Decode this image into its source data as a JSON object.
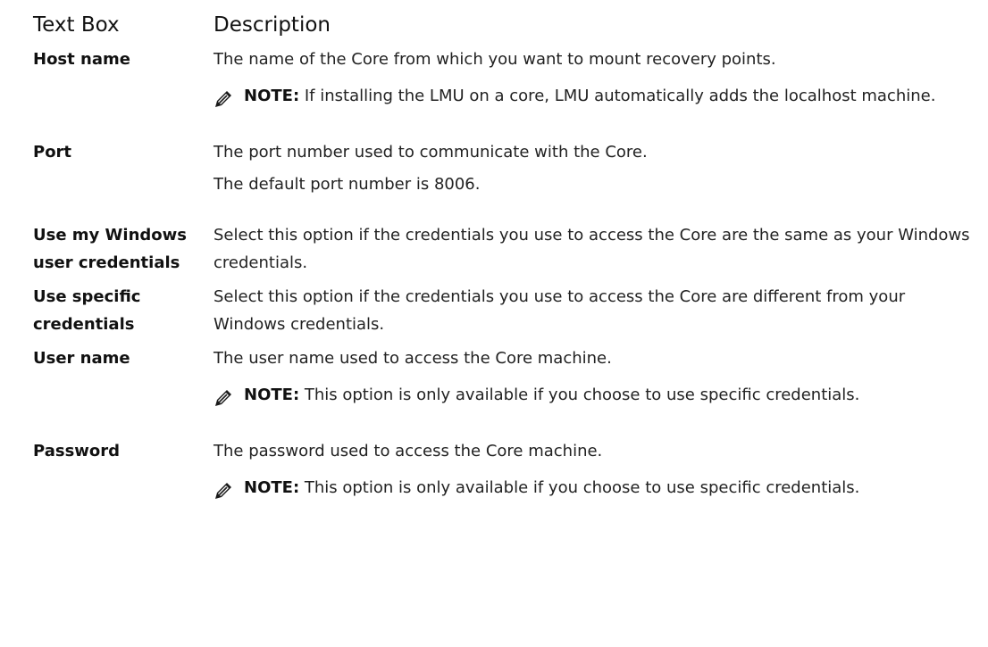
{
  "table": {
    "header": {
      "term": "Text Box",
      "description": "Description"
    },
    "rows": [
      {
        "term": "Host name",
        "description": [
          "The name of the Core from which you want to mount recovery points."
        ],
        "note": {
          "label": "NOTE:",
          "text": " If installing the LMU on a core, LMU automatically adds the localhost machine."
        }
      },
      {
        "term": "Port",
        "description": [
          "The port number used to communicate with the Core.",
          "The default port number is 8006."
        ]
      },
      {
        "term": "Use my Windows user credentials",
        "description": [
          "Select this option if the credentials you use to access the Core are the same as your Windows credentials."
        ]
      },
      {
        "term": "Use specific credentials",
        "description": [
          "Select this option if the credentials you use to access the Core are different from your Windows credentials."
        ]
      },
      {
        "term": "User name",
        "description": [
          "The user name used to access the Core machine."
        ],
        "note": {
          "label": "NOTE:",
          "text": " This option is only available if you choose to use specific credentials."
        }
      },
      {
        "term": "Password",
        "description": [
          "The password used to access the Core machine."
        ],
        "note": {
          "label": "NOTE:",
          "text": " This option is only available if you choose to use specific credentials."
        }
      }
    ]
  },
  "icons": {
    "note": "pencil-note-icon"
  },
  "colors": {
    "text": "#222222",
    "icon": "#1a1a1a"
  }
}
